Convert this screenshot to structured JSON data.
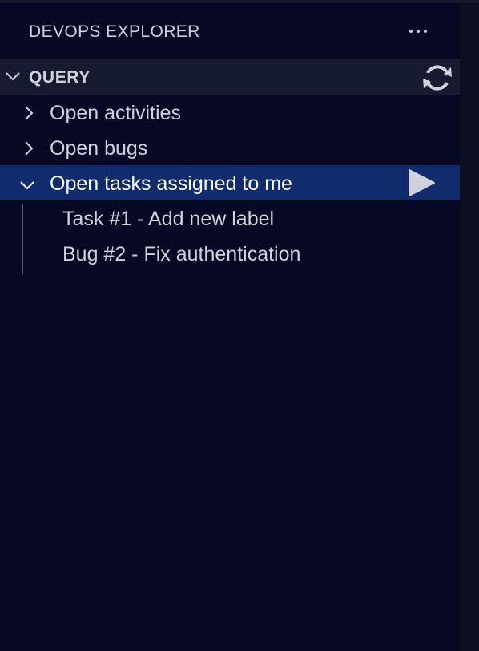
{
  "panel": {
    "title": "DEVOPS EXPLORER",
    "more_actions_icon": "ellipsis-icon"
  },
  "section": {
    "label": "QUERY",
    "expanded": true,
    "chevron_icon": "chevron-down-icon",
    "refresh_icon": "refresh-icon"
  },
  "tree": {
    "items": [
      {
        "label": "Open activities",
        "expanded": false,
        "icon": "chevron-right-icon"
      },
      {
        "label": "Open bugs",
        "expanded": false,
        "icon": "chevron-right-icon"
      },
      {
        "label": "Open tasks assigned to me",
        "expanded": true,
        "selected": true,
        "icon": "chevron-down-icon",
        "action_icon": "run-icon"
      }
    ],
    "children": [
      {
        "label": "Task #1 - Add new label"
      },
      {
        "label": "Bug #2 - Fix authentication"
      }
    ]
  },
  "colors": {
    "background": "#060824",
    "section_header": "#161b2f",
    "selection": "#102c6c",
    "text": "#cfd2dc"
  }
}
